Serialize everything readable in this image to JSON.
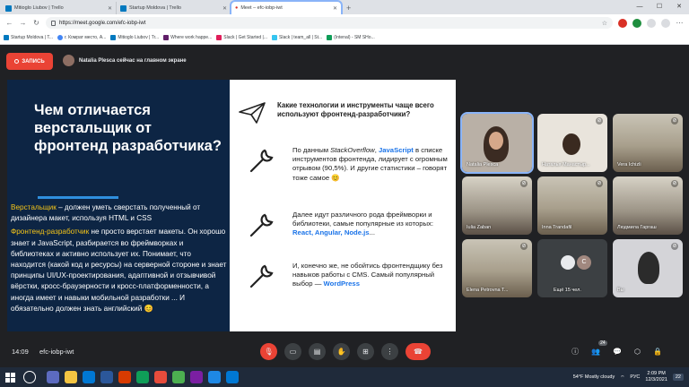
{
  "browser": {
    "tabs": [
      {
        "label": "Mitioglo Liubov | Trello",
        "icon": "trello-icon"
      },
      {
        "label": "Startup Moldova | Trello",
        "icon": "trello-icon"
      },
      {
        "label": "Meet – efc-iobp-iwt",
        "icon": "meet-icon",
        "active": true
      }
    ],
    "url": "https://meet.google.com/efc-iobp-iwt",
    "bookmarks": [
      "Startup Moldova | T...",
      "г. Комрат место, А...",
      "Mitioglo Liubov | Tr...",
      "Where work happe...",
      "Slack | Get Started |...",
      "Slack | team_all | St...",
      "(Intenal) - SM SHo..."
    ]
  },
  "meet": {
    "record_label": "ЗАПИСЬ",
    "presenter_text": "Natalia Plesca сейчас на главном экране",
    "slide": {
      "title": "Чем отличается верстальщик от фронтенд разработчика?",
      "p1_highlight": "Верстальщик",
      "p1_rest": " – должен уметь сверстать полученный от дизайнера макет, используя HTML и CSS",
      "p2_highlight": "Фронтенд-разработчик",
      "p2_rest": " не просто верстает макеты. Он хорошо знает и JavaScript, разбирается во фреймворках и библиотеках и активно использует их. Понимает, что находится (какой код и ресурсы) на серверной стороне и знает принципы UI/UX-проектирования, адаптивной и отзывчивой вёрстки, кросс-браузерности и кросс-платформенности, а иногда имеет и навыки мобильной разработки ... И обязательно должен знать английский 😊",
      "question": "Какие технологии и инструменты чаще всего используют фронтенд-разработчики?",
      "item1_a": "По данным ",
      "item1_so": "StackOverflow",
      "item1_b": ", ",
      "item1_js": "JavaScript",
      "item1_c": " в списке инструментов фронтенда, лидирует с огромным отрывом (90,5%). И другие статистики – говорят тоже самое 😊",
      "item2_a": "Далее идут различного рода фреймворки и библиотеки, самые популярные из которых: ",
      "item2_b": "React, Angular, Node.js",
      "item2_c": "...",
      "item3_a": "И, конечно же, не обойтись фронтендщику без навыков работы с CMS. Самый популярный выбор — ",
      "item3_b": "WordPress"
    },
    "participants": [
      {
        "name": "Natalia Plesca",
        "muted": false
      },
      {
        "name": "Наталья Манастыр...",
        "muted": true
      },
      {
        "name": "Vera Ichizli",
        "muted": true
      },
      {
        "name": "Iulia Zaban",
        "muted": true
      },
      {
        "name": "Inna Trandafil",
        "muted": true
      },
      {
        "name": "Людмила Гаргаш",
        "muted": true
      },
      {
        "name": "Elena Petrovna T...",
        "muted": true
      },
      {
        "name": "Ещё 15 чел.",
        "muted": false
      },
      {
        "name": "Вы",
        "muted": true
      }
    ],
    "more_initial": "C",
    "time": "14:09",
    "meeting_code": "efc-iobp-iwt",
    "people_count": "24"
  },
  "taskbar": {
    "weather": "54°F  Mostly cloudy",
    "lang": "РУС",
    "time": "2:09 PM",
    "date": "12/3/2021",
    "notif_count": "22"
  }
}
